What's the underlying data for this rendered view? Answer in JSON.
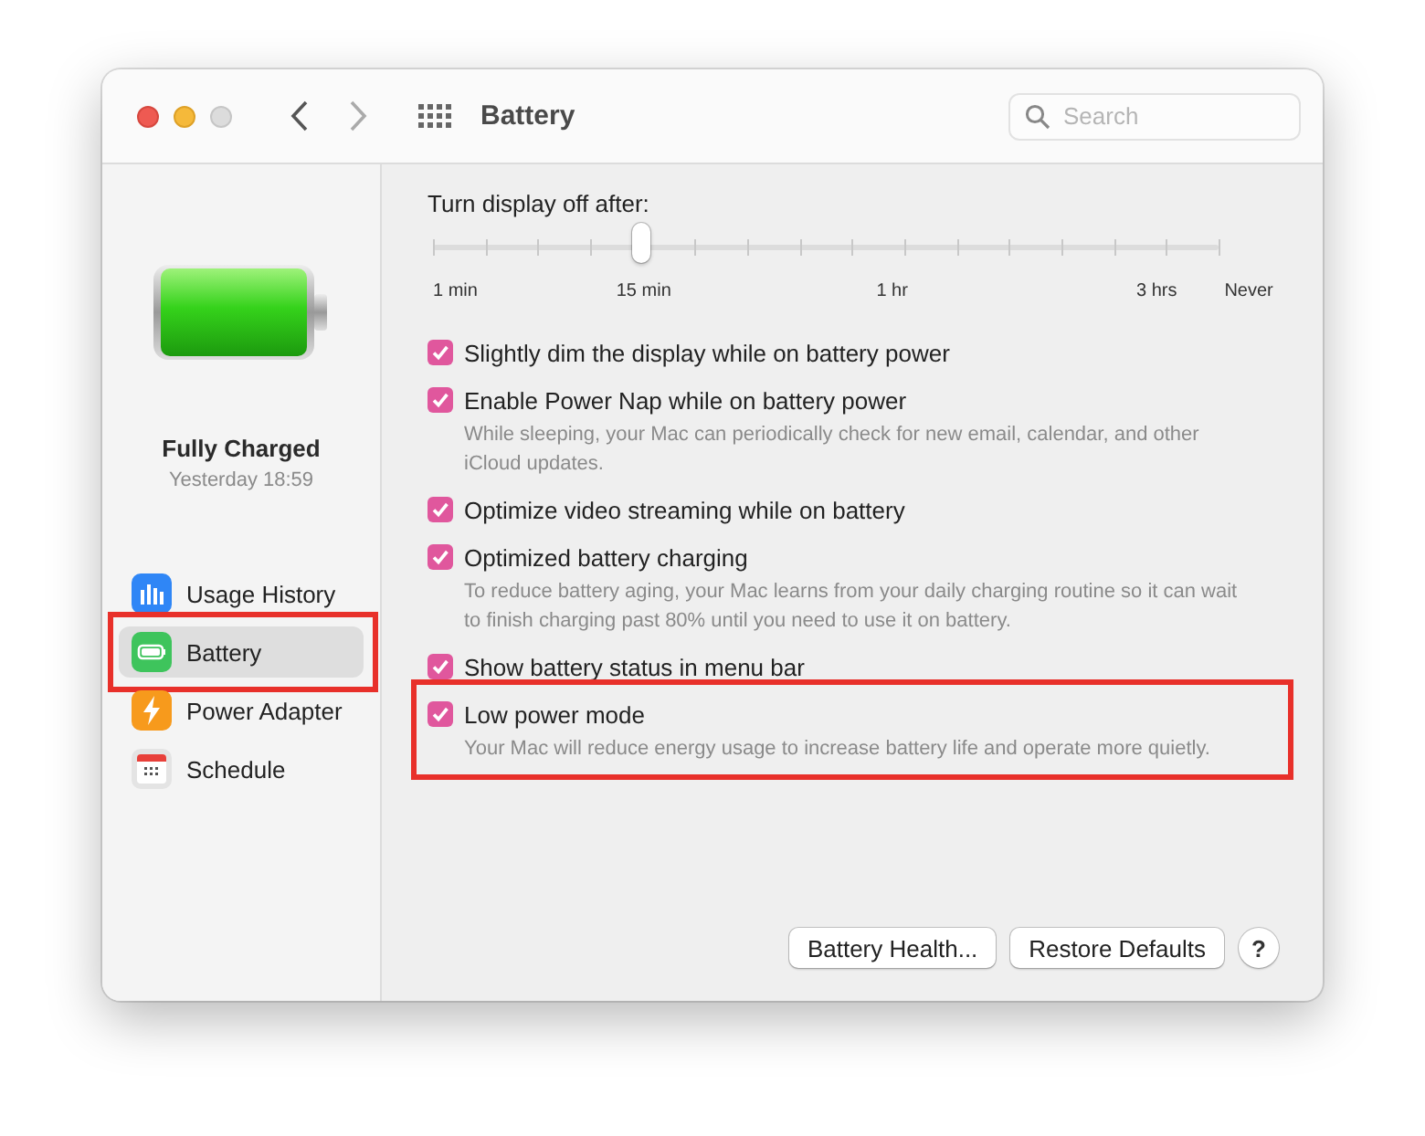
{
  "window": {
    "title": "Battery",
    "search": {
      "placeholder": "Search"
    }
  },
  "sidebar": {
    "status": "Fully Charged",
    "time": "Yesterday 18:59",
    "items": [
      {
        "label": "Usage History",
        "kind": "usage",
        "selected": false,
        "highlighted": false
      },
      {
        "label": "Battery",
        "kind": "battery",
        "selected": true,
        "highlighted": true
      },
      {
        "label": "Power Adapter",
        "kind": "power",
        "selected": false,
        "highlighted": false
      },
      {
        "label": "Schedule",
        "kind": "schedule",
        "selected": false,
        "highlighted": false
      }
    ]
  },
  "display_off": {
    "label": "Turn display off after:",
    "level": 0.266,
    "ticks": [
      "1 min",
      "15 min",
      "1 hr",
      "3 hrs",
      "Never"
    ]
  },
  "options": [
    {
      "label": "Slightly dim the display while on battery power",
      "checked": true,
      "highlighted": false
    },
    {
      "label": "Enable Power Nap while on battery power",
      "checked": true,
      "highlighted": false,
      "description": "While sleeping, your Mac can periodically check for new email, calendar, and other iCloud updates."
    },
    {
      "label": "Optimize video streaming while on battery",
      "checked": true,
      "highlighted": false
    },
    {
      "label": "Optimized battery charging",
      "checked": true,
      "highlighted": false,
      "description": "To reduce battery aging, your Mac learns from your daily charging routine so it can wait to finish charging past 80% until you need to use it on battery."
    },
    {
      "label": "Show battery status in menu bar",
      "checked": true,
      "highlighted": false
    },
    {
      "label": "Low power mode",
      "checked": true,
      "highlighted": true,
      "description": "Your Mac will reduce energy usage to increase battery life and operate more quietly."
    }
  ],
  "buttons": [
    "Battery Health...",
    "Restore Defaults"
  ],
  "help": "?"
}
